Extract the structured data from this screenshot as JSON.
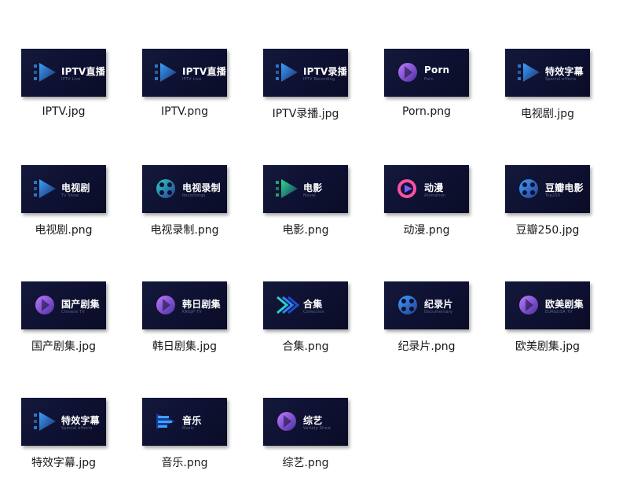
{
  "files": [
    {
      "name": "IPTV.jpg",
      "title": "IPTV直播",
      "subtitle": "IPTV Live",
      "icon": "play-arrow-icon",
      "accent": "#3aa3ff"
    },
    {
      "name": "IPTV.png",
      "title": "IPTV直播",
      "subtitle": "IPTV Live",
      "icon": "play-arrow-icon",
      "accent": "#3aa3ff"
    },
    {
      "name": "IPTV录播.jpg",
      "title": "IPTV录播",
      "subtitle": "IPTV Recording",
      "icon": "play-arrow-icon",
      "accent": "#3aa3ff"
    },
    {
      "name": "Porn.png",
      "title": "Porn",
      "subtitle": "Porn",
      "icon": "purple-orb-icon",
      "accent": "#a45cff"
    },
    {
      "name": "电视剧.jpg",
      "title": "特效字幕",
      "subtitle": "Special effects",
      "icon": "play-arrow-icon",
      "accent": "#3aa3ff"
    },
    {
      "name": "电视剧.png",
      "title": "电视剧",
      "subtitle": "Tv Show",
      "icon": "play-arrow-icon",
      "accent": "#3aa3ff"
    },
    {
      "name": "电视录制.png",
      "title": "电视录制",
      "subtitle": "Recordings",
      "icon": "film-reel-icon",
      "accent": "#2bd1c9"
    },
    {
      "name": "电影.png",
      "title": "电影",
      "subtitle": "Movie",
      "icon": "play-arrow-icon",
      "accent": "#2ee08a"
    },
    {
      "name": "动漫.png",
      "title": "动漫",
      "subtitle": "Animation",
      "icon": "ring-icon",
      "accent": "#ff4fa3"
    },
    {
      "name": "豆瓣250.jpg",
      "title": "豆瓣电影",
      "subtitle": "Top250",
      "icon": "film-reel-icon",
      "accent": "#3aa3ff"
    },
    {
      "name": "国产剧集.jpg",
      "title": "国产剧集",
      "subtitle": "Chinese TV",
      "icon": "purple-orb-icon",
      "accent": "#a45cff"
    },
    {
      "name": "韩日剧集.jpg",
      "title": "韩日剧集",
      "subtitle": "KR&JP TV",
      "icon": "purple-orb-icon",
      "accent": "#a45cff"
    },
    {
      "name": "合集.png",
      "title": "合集",
      "subtitle": "Collection",
      "icon": "stack-arrows-icon",
      "accent": "#2bd1c9"
    },
    {
      "name": "纪录片.png",
      "title": "纪录片",
      "subtitle": "Documentary",
      "icon": "film-reel-icon",
      "accent": "#3aa3ff"
    },
    {
      "name": "欧美剧集.jpg",
      "title": "欧美剧集",
      "subtitle": "EUR&USA TV",
      "icon": "purple-orb-icon",
      "accent": "#a45cff"
    },
    {
      "name": "特效字幕.jpg",
      "title": "特效字幕",
      "subtitle": "Special effects",
      "icon": "play-arrow-icon",
      "accent": "#3aa3ff"
    },
    {
      "name": "音乐.png",
      "title": "音乐",
      "subtitle": "Music",
      "icon": "music-bars-icon",
      "accent": "#3aa3ff"
    },
    {
      "name": "综艺.png",
      "title": "综艺",
      "subtitle": "Variety Show",
      "icon": "purple-orb-icon",
      "accent": "#a45cff"
    }
  ]
}
